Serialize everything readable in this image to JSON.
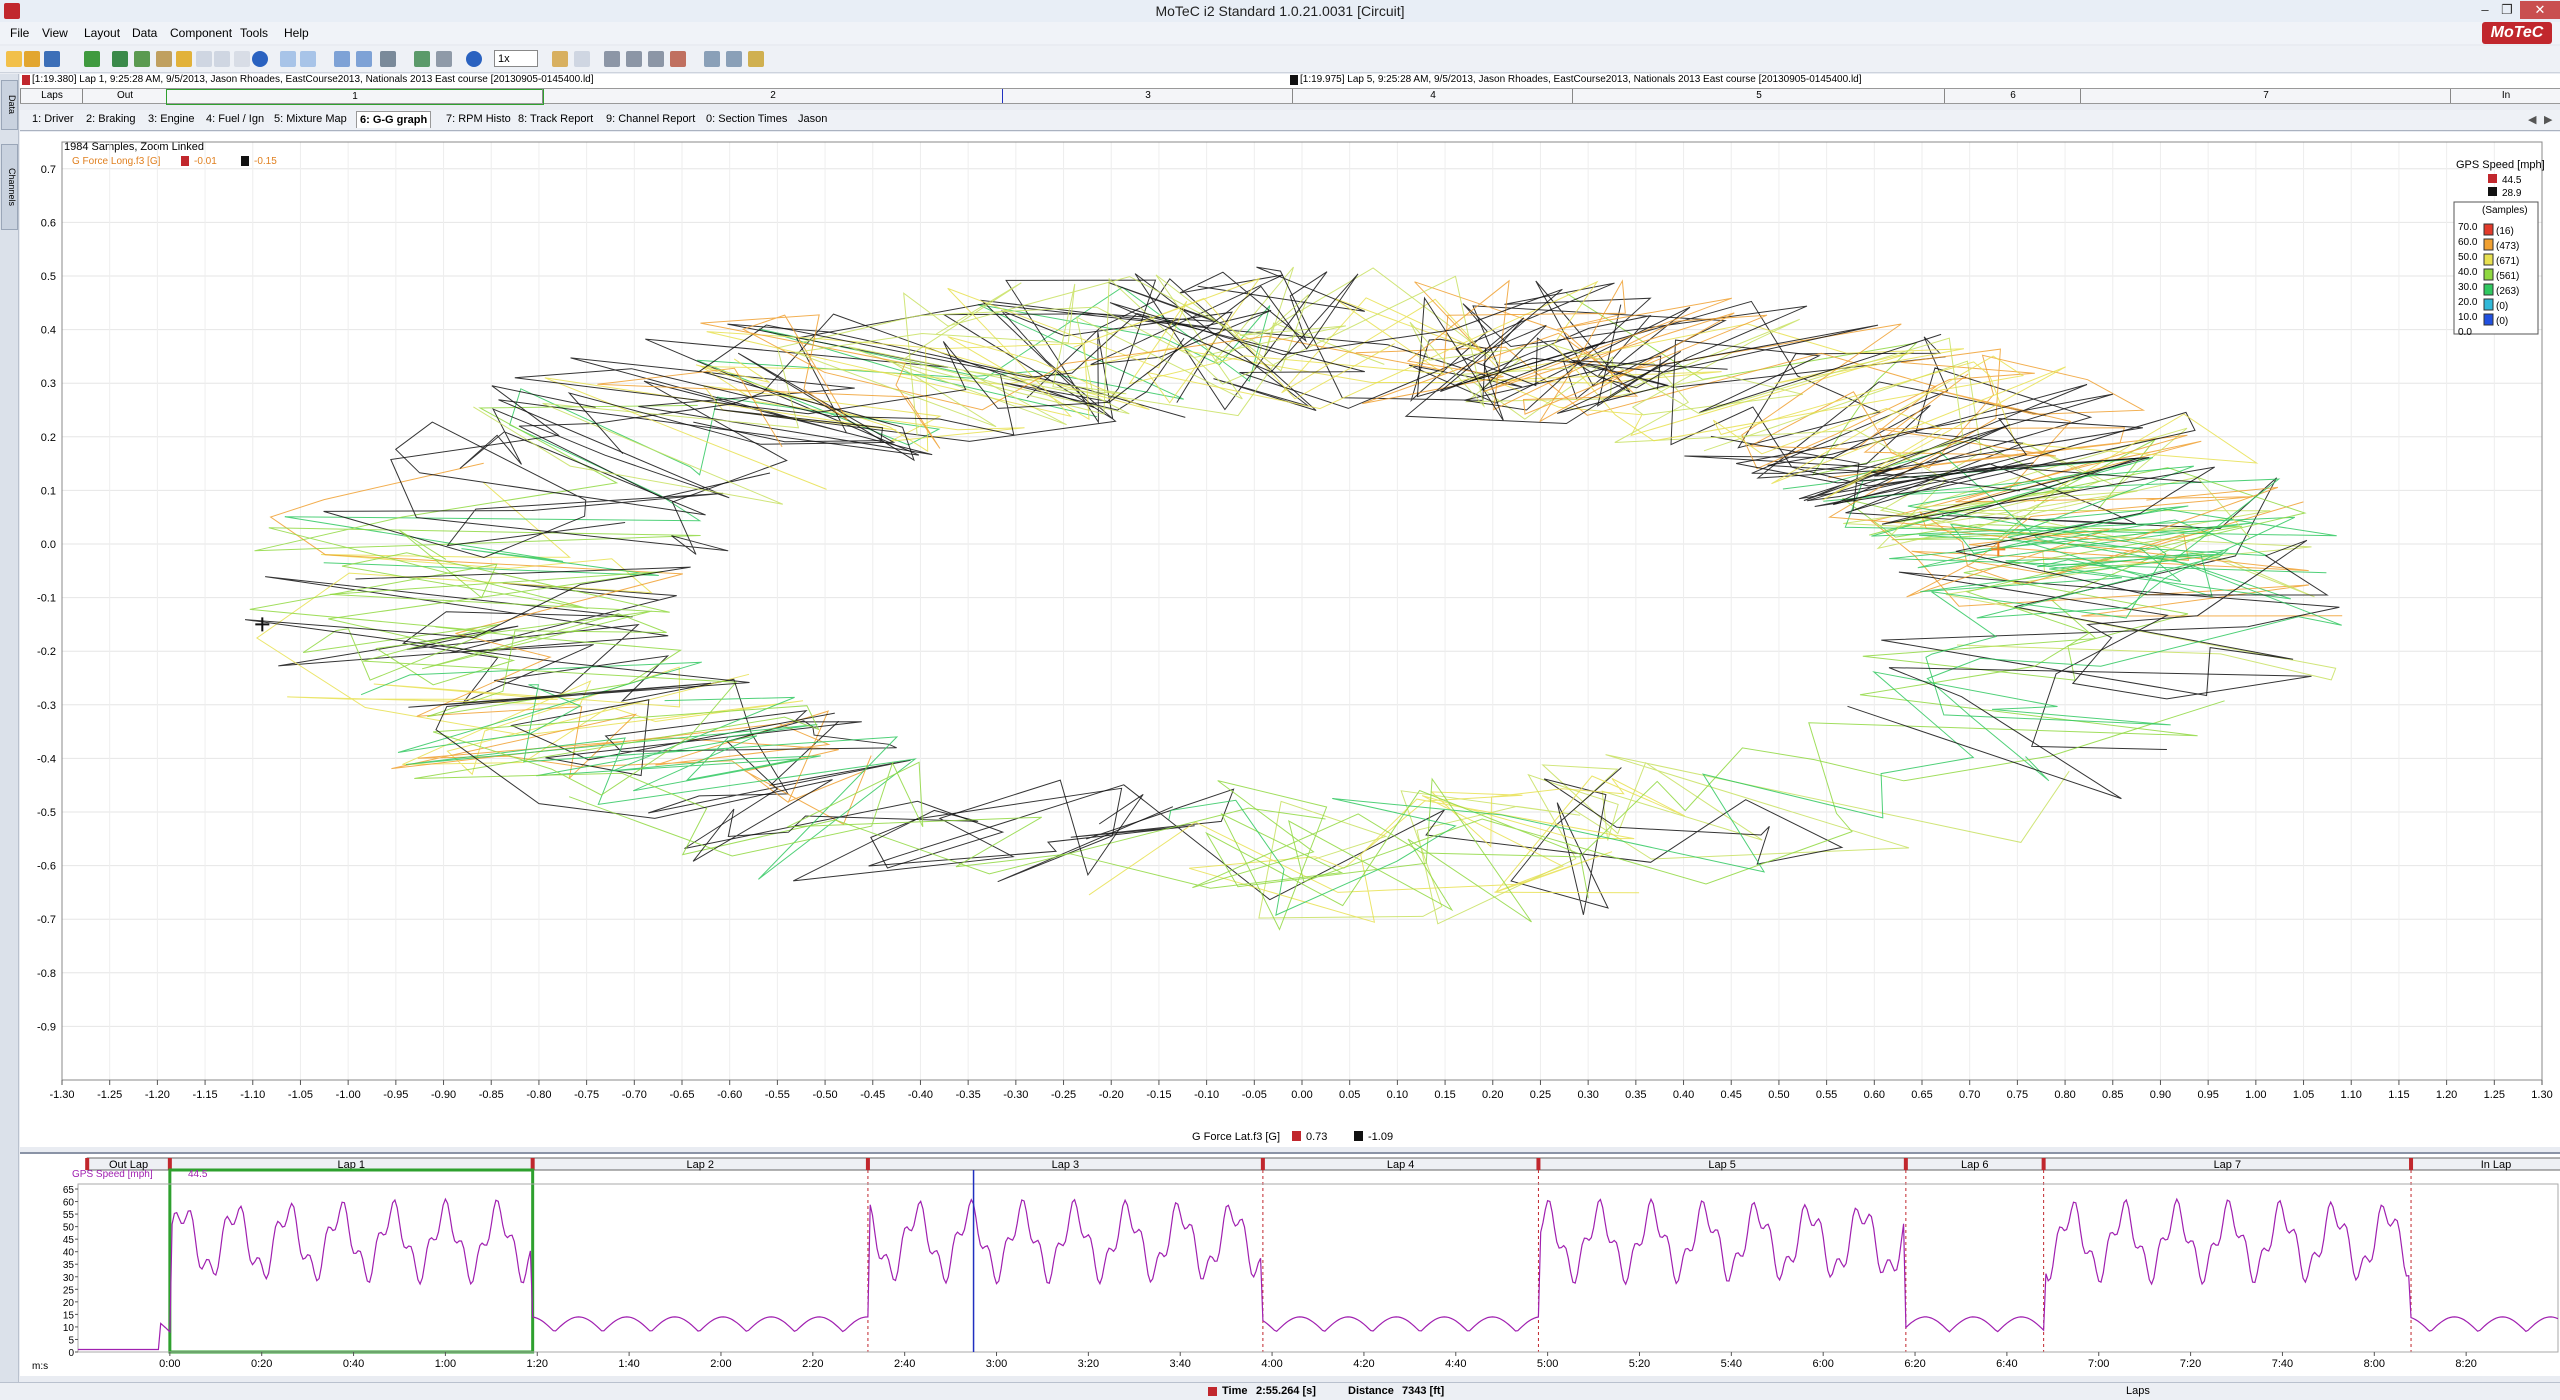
{
  "window": {
    "title": "MoTeC i2 Standard 1.0.21.0031  [Circuit]",
    "logo": "MoTeC"
  },
  "menu": [
    "File",
    "View",
    "Layout",
    "Data",
    "Component",
    "Tools",
    "Help"
  ],
  "toolbar": {
    "zoom_value": "1x"
  },
  "side_tabs": [
    "Data",
    "Channels"
  ],
  "info": {
    "left": "[1:19.380] Lap 1, 9:25:28 AM, 9/5/2013, Jason Rhoades, EastCourse2013, Nationals 2013 East course [20130905-0145400.ld]",
    "right": "[1:19.975] Lap 5, 9:25:28 AM, 9/5/2013, Jason Rhoades, EastCourse2013, Nationals 2013 East course [20130905-0145400.ld]"
  },
  "laps_bar": {
    "label": "Laps",
    "items": [
      "Out",
      "1",
      "2",
      "3",
      "4",
      "5",
      "6",
      "7",
      "In"
    ]
  },
  "tabs": [
    "1: Driver",
    "2: Braking",
    "3: Engine",
    "4: Fuel / Ign",
    "5: Mixture Map",
    "6: G-G graph",
    "7: RPM Histo",
    "8: Track Report",
    "9: Channel Report",
    "0: Section Times",
    "Jason"
  ],
  "active_tab": "6: G-G graph",
  "chart_data": [
    {
      "type": "scatter",
      "subtitle": "1984 Samples, Zoom Linked",
      "ylabel": "G Force Long.f3 [G]",
      "y_cursor_vals": [
        "-0.01",
        "-0.15"
      ],
      "xlabel": "G Force Lat.f3 [G]",
      "x_cursor_vals": [
        "0.73",
        "-1.09"
      ],
      "xlim": [
        -1.3,
        1.3
      ],
      "ylim": [
        -1.0,
        0.75
      ],
      "x_ticks": [
        "-1.30",
        "-1.25",
        "-1.20",
        "-1.15",
        "-1.10",
        "-1.05",
        "-1.00",
        "-0.95",
        "-0.90",
        "-0.85",
        "-0.80",
        "-0.75",
        "-0.70",
        "-0.65",
        "-0.60",
        "-0.55",
        "-0.50",
        "-0.45",
        "-0.40",
        "-0.35",
        "-0.30",
        "-0.25",
        "-0.20",
        "-0.15",
        "-0.10",
        "-0.05",
        "0.00",
        "0.05",
        "0.10",
        "0.15",
        "0.20",
        "0.25",
        "0.30",
        "0.35",
        "0.40",
        "0.45",
        "0.50",
        "0.55",
        "0.60",
        "0.65",
        "0.70",
        "0.75",
        "0.80",
        "0.85",
        "0.90",
        "0.95",
        "1.00",
        "1.05",
        "1.10",
        "1.15",
        "1.20",
        "1.25",
        "1.30"
      ],
      "y_ticks": [
        "0.7",
        "0.6",
        "0.5",
        "0.4",
        "0.3",
        "0.2",
        "0.1",
        "0.0",
        "-0.1",
        "-0.2",
        "-0.3",
        "-0.4",
        "-0.5",
        "-0.6",
        "-0.7",
        "-0.8",
        "-0.9"
      ],
      "color_channel": {
        "name": "GPS Speed [mph]",
        "cursor_vals": [
          "44.5",
          "28.9"
        ],
        "legend_title": "(Samples)",
        "bins": [
          {
            "value": "70.0",
            "count": "(16)",
            "color": "#e23a2a"
          },
          {
            "value": "60.0",
            "count": "(473)",
            "color": "#f0a030"
          },
          {
            "value": "50.0",
            "count": "(671)",
            "color": "#e8e050"
          },
          {
            "value": "40.0",
            "count": "(561)",
            "color": "#8fd840"
          },
          {
            "value": "30.0",
            "count": "(263)",
            "color": "#30c860"
          },
          {
            "value": "20.0",
            "count": "(0)",
            "color": "#30b8d8"
          },
          {
            "value": "10.0",
            "count": "(0)",
            "color": "#2050e0"
          },
          {
            "value": "0.0",
            "count": "",
            "color": "#2050e0"
          }
        ]
      }
    },
    {
      "type": "line",
      "series": [
        {
          "name": "GPS Speed [mph]",
          "cursor_val": "44.5",
          "color": "#a020b0"
        }
      ],
      "y_ticks": [
        "65",
        "60",
        "55",
        "50",
        "45",
        "40",
        "35",
        "30",
        "25",
        "20",
        "15",
        "10",
        "5",
        "0"
      ],
      "ylim": [
        0,
        67
      ],
      "x_unit": "m:s",
      "x_ticks": [
        "0:00",
        "0:20",
        "0:40",
        "1:00",
        "1:20",
        "1:40",
        "2:00",
        "2:20",
        "2:40",
        "3:00",
        "3:20",
        "3:40",
        "4:00",
        "4:20",
        "4:40",
        "5:00",
        "5:20",
        "5:40",
        "6:00",
        "6:20",
        "6:40",
        "7:00",
        "7:20",
        "7:40",
        "8:00",
        "8:20"
      ],
      "xlim_seconds": [
        -20,
        520
      ],
      "lap_labels": [
        "Out Lap",
        "Lap 1",
        "Lap 2",
        "Lap 3",
        "Lap 4",
        "Lap 5",
        "Lap 6",
        "Lap 7",
        "In Lap"
      ],
      "lap_bounds_seconds": [
        -18,
        0,
        79,
        152,
        238,
        298,
        378,
        408,
        488,
        525
      ]
    }
  ],
  "status": {
    "time_label": "Time",
    "time_value": "2:55.264 [s]",
    "distance_label": "Distance",
    "distance_value": "7343 [ft]",
    "axis_label": "Laps"
  }
}
